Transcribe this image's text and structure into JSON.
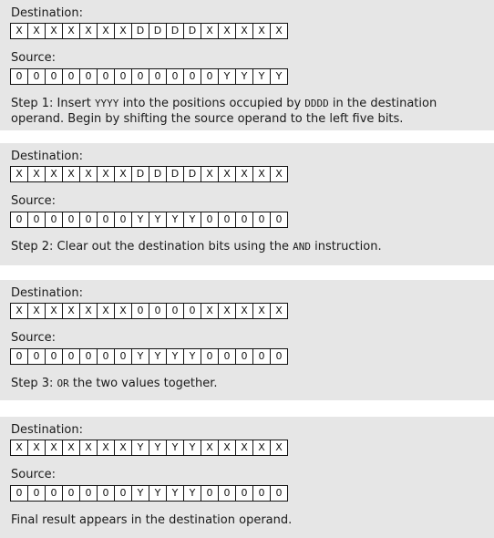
{
  "dest_label": "Destination:",
  "src_label": "Source:",
  "steps": [
    {
      "dest": [
        "X",
        "X",
        "X",
        "X",
        "X",
        "X",
        "X",
        "D",
        "D",
        "D",
        "D",
        "X",
        "X",
        "X",
        "X",
        "X"
      ],
      "src": [
        "0",
        "0",
        "0",
        "0",
        "0",
        "0",
        "0",
        "0",
        "0",
        "0",
        "0",
        "0",
        "Y",
        "Y",
        "Y",
        "Y"
      ],
      "caption": [
        [
          "Step 1: Insert ",
          false
        ],
        [
          "YYYY",
          true
        ],
        [
          " into the positions occupied by ",
          false
        ],
        [
          "DDDD",
          true
        ],
        [
          " in the destination operand. Begin by shifting the source operand to the left five bits.",
          false
        ]
      ]
    },
    {
      "dest": [
        "X",
        "X",
        "X",
        "X",
        "X",
        "X",
        "X",
        "D",
        "D",
        "D",
        "D",
        "X",
        "X",
        "X",
        "X",
        "X"
      ],
      "src": [
        "0",
        "0",
        "0",
        "0",
        "0",
        "0",
        "0",
        "Y",
        "Y",
        "Y",
        "Y",
        "0",
        "0",
        "0",
        "0",
        "0"
      ],
      "caption": [
        [
          "Step 2: Clear out the destination bits using the ",
          false
        ],
        [
          "AND",
          true
        ],
        [
          " instruction.",
          false
        ]
      ]
    },
    {
      "dest": [
        "X",
        "X",
        "X",
        "X",
        "X",
        "X",
        "X",
        "0",
        "0",
        "0",
        "0",
        "X",
        "X",
        "X",
        "X",
        "X"
      ],
      "src": [
        "0",
        "0",
        "0",
        "0",
        "0",
        "0",
        "0",
        "Y",
        "Y",
        "Y",
        "Y",
        "0",
        "0",
        "0",
        "0",
        "0"
      ],
      "caption": [
        [
          "Step 3: ",
          false
        ],
        [
          "OR",
          true
        ],
        [
          " the two values together.",
          false
        ]
      ]
    },
    {
      "dest": [
        "X",
        "X",
        "X",
        "X",
        "X",
        "X",
        "X",
        "Y",
        "Y",
        "Y",
        "Y",
        "X",
        "X",
        "X",
        "X",
        "X"
      ],
      "src": [
        "0",
        "0",
        "0",
        "0",
        "0",
        "0",
        "0",
        "Y",
        "Y",
        "Y",
        "Y",
        "0",
        "0",
        "0",
        "0",
        "0"
      ],
      "caption": [
        [
          "Final result appears in the destination operand.",
          false
        ]
      ]
    }
  ]
}
